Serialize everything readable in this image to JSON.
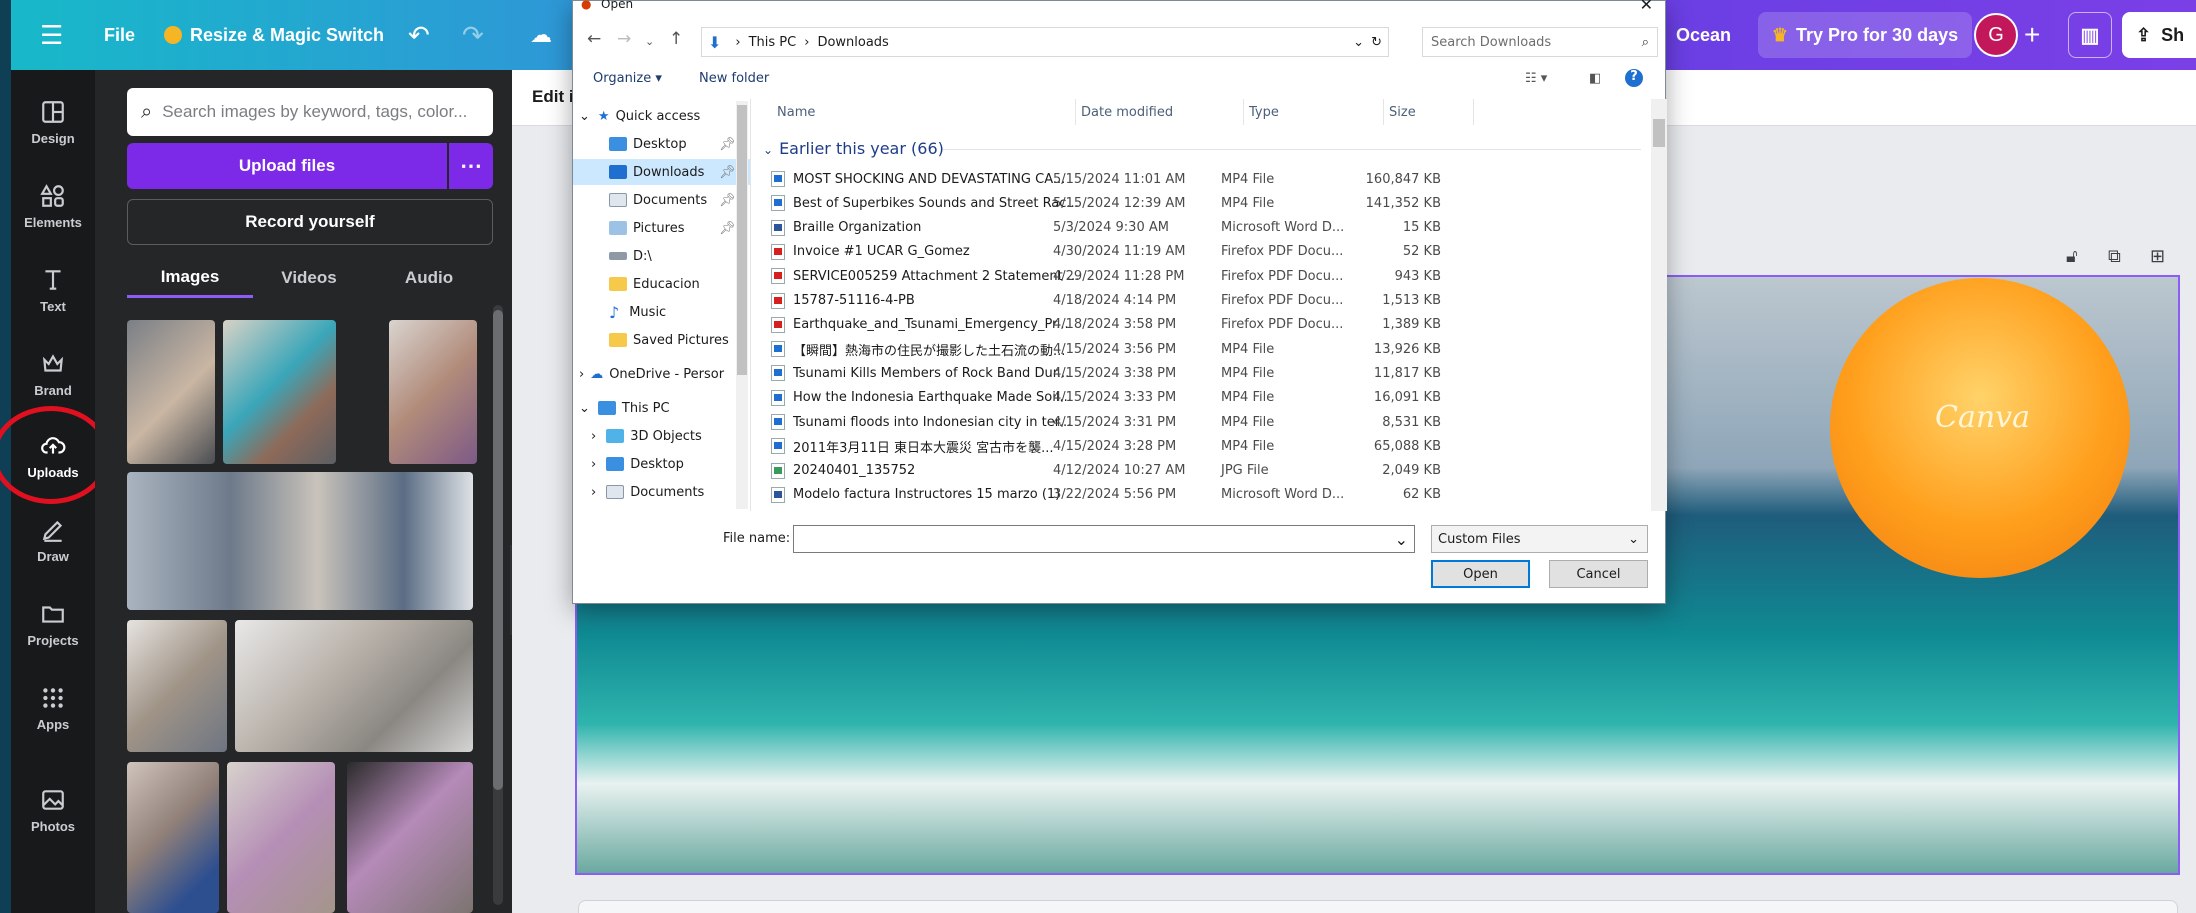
{
  "topbar": {
    "file": "File",
    "resize": "Resize & Magic Switch",
    "doc_title": "Ocean",
    "try_pro": "Try Pro for 30 days",
    "avatar": "G",
    "share": "Sh"
  },
  "rail": {
    "items": [
      {
        "label": "Design",
        "icon": "layout-icon"
      },
      {
        "label": "Elements",
        "icon": "shapes-icon"
      },
      {
        "label": "Text",
        "icon": "text-icon"
      },
      {
        "label": "Brand",
        "icon": "crown-icon"
      },
      {
        "label": "Uploads",
        "icon": "cloud-upload-icon"
      },
      {
        "label": "Draw",
        "icon": "pen-icon"
      },
      {
        "label": "Projects",
        "icon": "folder-icon"
      },
      {
        "label": "Apps",
        "icon": "grid-icon"
      },
      {
        "label": "Photos",
        "icon": "image-icon"
      }
    ]
  },
  "panel": {
    "search_placeholder": "Search images by keyword, tags, color...",
    "upload_button": "Upload files",
    "record_button": "Record yourself",
    "tabs": [
      "Images",
      "Videos",
      "Audio"
    ]
  },
  "editor": {
    "edit_label": "Edit i",
    "canvas_logo": "Canva"
  },
  "dialog": {
    "title": "Open",
    "breadcrumb": [
      "This PC",
      "Downloads"
    ],
    "search_placeholder": "Search Downloads",
    "organize": "Organize",
    "new_folder": "New folder",
    "tree": [
      {
        "label": "Quick access",
        "level": 0
      },
      {
        "label": "Desktop",
        "level": 1
      },
      {
        "label": "Downloads",
        "level": 1,
        "selected": true
      },
      {
        "label": "Documents",
        "level": 1
      },
      {
        "label": "Pictures",
        "level": 1
      },
      {
        "label": "D:\\",
        "level": 1
      },
      {
        "label": "Educacion",
        "level": 1
      },
      {
        "label": "Music",
        "level": 1
      },
      {
        "label": "Saved Pictures",
        "level": 1
      },
      {
        "label": "OneDrive - Persor",
        "level": 0
      },
      {
        "label": "This PC",
        "level": 0
      },
      {
        "label": "3D Objects",
        "level": 1
      },
      {
        "label": "Desktop",
        "level": 1
      },
      {
        "label": "Documents",
        "level": 1
      }
    ],
    "columns": [
      "Name",
      "Date modified",
      "Type",
      "Size"
    ],
    "group": "Earlier this year (66)",
    "files": [
      {
        "name": "MOST SHOCKING AND DEVASTATING CA...",
        "date": "5/15/2024 11:01 AM",
        "type": "MP4 File",
        "size": "160,847 KB",
        "kind": "mp4"
      },
      {
        "name": "Best of Superbikes Sounds and Street Rac...",
        "date": "5/15/2024 12:39 AM",
        "type": "MP4 File",
        "size": "141,352 KB",
        "kind": "mp4"
      },
      {
        "name": "Braille Organization",
        "date": "5/3/2024 9:30 AM",
        "type": "Microsoft Word D...",
        "size": "15 KB",
        "kind": "word"
      },
      {
        "name": "Invoice #1 UCAR G_Gomez",
        "date": "4/30/2024 11:19 AM",
        "type": "Firefox PDF Docu...",
        "size": "52 KB",
        "kind": "pdf"
      },
      {
        "name": "SERVICE005259 Attachment 2 Statement ...",
        "date": "4/29/2024 11:28 PM",
        "type": "Firefox PDF Docu...",
        "size": "943 KB",
        "kind": "pdf"
      },
      {
        "name": "15787-51116-4-PB",
        "date": "4/18/2024 4:14 PM",
        "type": "Firefox PDF Docu...",
        "size": "1,513 KB",
        "kind": "pdf"
      },
      {
        "name": "Earthquake_and_Tsunami_Emergency_Pr...",
        "date": "4/18/2024 3:58 PM",
        "type": "Firefox PDF Docu...",
        "size": "1,389 KB",
        "kind": "pdf"
      },
      {
        "name": "【瞬間】熱海市の住民が撮影した土石流の動...",
        "date": "4/15/2024 3:56 PM",
        "type": "MP4 File",
        "size": "13,926 KB",
        "kind": "mp4"
      },
      {
        "name": "Tsunami Kills Members of Rock Band Dur...",
        "date": "4/15/2024 3:38 PM",
        "type": "MP4 File",
        "size": "11,817 KB",
        "kind": "mp4"
      },
      {
        "name": "How the Indonesia Earthquake Made Soil...",
        "date": "4/15/2024 3:33 PM",
        "type": "MP4 File",
        "size": "16,091 KB",
        "kind": "mp4"
      },
      {
        "name": "Tsunami floods into Indonesian city in ter...",
        "date": "4/15/2024 3:31 PM",
        "type": "MP4 File",
        "size": "8,531 KB",
        "kind": "mp4"
      },
      {
        "name": "2011年3月11日 東日本大震災 宮古市を襲...",
        "date": "4/15/2024 3:28 PM",
        "type": "MP4 File",
        "size": "65,088 KB",
        "kind": "mp4"
      },
      {
        "name": "20240401_135752",
        "date": "4/12/2024 10:27 AM",
        "type": "JPG File",
        "size": "2,049 KB",
        "kind": "jpg"
      },
      {
        "name": "Modelo factura Instructores 15 marzo (1)",
        "date": "3/22/2024 5:56 PM",
        "type": "Microsoft Word D...",
        "size": "62 KB",
        "kind": "word"
      }
    ],
    "file_name_label": "File name:",
    "file_name_value": "",
    "file_type": "Custom Files",
    "open_button": "Open",
    "cancel_button": "Cancel"
  }
}
